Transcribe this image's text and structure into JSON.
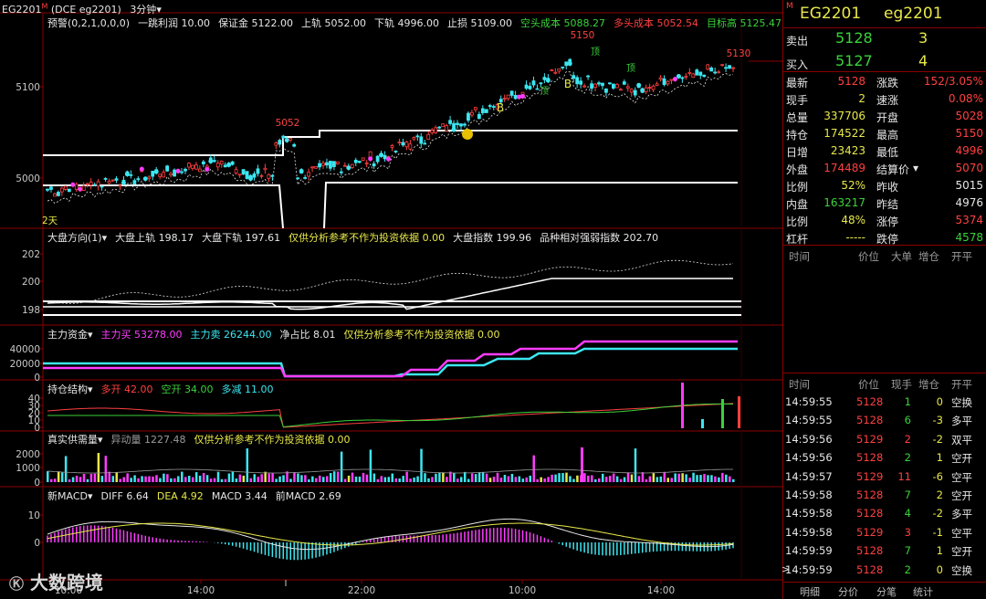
{
  "window": {
    "title": "EG2201",
    "marker": "M",
    "subtitle": "(DCE  eg2201)",
    "period": "3分钟"
  },
  "main_panel": {
    "label": "预警(0,2,1,0,0,0)",
    "items": [
      {
        "text": "一跳利润 10.00",
        "color": "#e6e6e6"
      },
      {
        "text": "保证金 5122.00",
        "color": "#e6e6e6"
      },
      {
        "text": "上轨 5052.00",
        "color": "#e6e6e6"
      },
      {
        "text": "下轨 4996.00",
        "color": "#e6e6e6"
      },
      {
        "text": "止损 5109.00",
        "color": "#e6e6e6"
      },
      {
        "text": "空头成本 5088.27",
        "color": "#3ad23a"
      },
      {
        "text": "多头成本 5052.54",
        "color": "#ff4040"
      },
      {
        "text": "目标高 5125.47",
        "color": "#3ad23a"
      }
    ],
    "y_ticks": [
      "5100",
      "5000"
    ],
    "annotations": {
      "high_a": "5150",
      "high_b": "5130",
      "mid": "5052",
      "days": "2天",
      "top1": "顶",
      "top2": "顶",
      "top3": "顶",
      "buy1": "B",
      "buy2": "B"
    }
  },
  "panel2": {
    "label": "大盘方向(1)",
    "items": [
      {
        "text": "大盘上轨 198.17",
        "color": "#e6e6e6"
      },
      {
        "text": "大盘下轨 197.61",
        "color": "#e6e6e6"
      },
      {
        "text": "仅供分析参考不作为投资依据 0.00",
        "color": "#e8e84a"
      },
      {
        "text": "大盘指数 199.96",
        "color": "#e6e6e6"
      },
      {
        "text": "品种相对强弱指数 202.70",
        "color": "#e6e6e6"
      }
    ],
    "y_ticks": [
      "202",
      "200",
      "198"
    ]
  },
  "panel3": {
    "label": "主力资金",
    "items": [
      {
        "text": "主力买 53278.00",
        "color": "#ff3cff"
      },
      {
        "text": "主力卖 26244.00",
        "color": "#3ce6f0"
      },
      {
        "text": "净占比 8.01",
        "color": "#e6e6e6"
      },
      {
        "text": "仅供分析参考不作为投资依据 0.00",
        "color": "#e8e84a"
      }
    ],
    "y_ticks": [
      "40000",
      "20000",
      "0"
    ]
  },
  "panel4": {
    "label": "持仓结构",
    "items": [
      {
        "text": "多开 42.00",
        "color": "#ff4040"
      },
      {
        "text": "空开 34.00",
        "color": "#3ad23a"
      },
      {
        "text": "多减 11.00",
        "color": "#3ce6f0"
      }
    ],
    "y_ticks": [
      "40",
      "30",
      "20",
      "10",
      "0"
    ]
  },
  "panel5": {
    "label": "真实供需量",
    "items": [
      {
        "text": "异动量 1227.48",
        "color": "#9a9a9a"
      },
      {
        "text": "仅供分析参考不作为投资依据 0.00",
        "color": "#e8e84a"
      }
    ],
    "y_ticks": [
      "2000",
      "1000",
      "0"
    ]
  },
  "panel6": {
    "label": "新MACD",
    "items": [
      {
        "text": "DIFF 6.64",
        "color": "#e6e6e6"
      },
      {
        "text": "DEA 4.92",
        "color": "#e8e84a"
      },
      {
        "text": "MACD 3.44",
        "color": "#e6e6e6"
      },
      {
        "text": "前MACD 2.69",
        "color": "#e6e6e6"
      }
    ],
    "y_ticks": [
      "10",
      "0"
    ]
  },
  "x_axis": {
    "ticks": [
      "10:00",
      "14:00",
      "22:00",
      "10:00",
      "14:00"
    ]
  },
  "watermark": "大数跨境",
  "quote": {
    "symbol": "EG2201",
    "symbol_lower": "eg2201",
    "marker": "M",
    "sell_label": "卖出",
    "sell_price": "5128",
    "sell_vol": "3",
    "buy_label": "买入",
    "buy_price": "5127",
    "buy_vol": "4",
    "rows": [
      {
        "l1": "最新",
        "v1": "5128",
        "c1": "#ff4040",
        "l2": "涨跌",
        "v2": "152/3.05%",
        "c2": "#ff4040"
      },
      {
        "l1": "现手",
        "v1": "2",
        "c1": "#e8e84a",
        "l2": "速涨",
        "v2": "0.08%",
        "c2": "#ff4040"
      },
      {
        "l1": "总量",
        "v1": "337706",
        "c1": "#e8e84a",
        "l2": "开盘",
        "v2": "5028",
        "c2": "#ff4040"
      },
      {
        "l1": "持仓",
        "v1": "174522",
        "c1": "#e8e84a",
        "l2": "最高",
        "v2": "5150",
        "c2": "#ff4040"
      },
      {
        "l1": "日增",
        "v1": "23423",
        "c1": "#e8e84a",
        "l2": "最低",
        "v2": "4996",
        "c2": "#ff4040"
      },
      {
        "l1": "外盘",
        "v1": "174489",
        "c1": "#ff4040",
        "l2": "结算价",
        "v2": "5070",
        "c2": "#ff4040"
      },
      {
        "l1": "比例",
        "v1": "52%",
        "c1": "#e8e84a",
        "l2": "昨收",
        "v2": "5015",
        "c2": "#e6e6e6"
      },
      {
        "l1": "内盘",
        "v1": "163217",
        "c1": "#3ad23a",
        "l2": "昨结",
        "v2": "4976",
        "c2": "#e6e6e6"
      },
      {
        "l1": "比例",
        "v1": "48%",
        "c1": "#e8e84a",
        "l2": "涨停",
        "v2": "5374",
        "c2": "#ff4040"
      },
      {
        "l1": "杠杆",
        "v1": "-----",
        "c1": "#e8e84a",
        "l2": "跌停",
        "v2": "4578",
        "c2": "#3ad23a"
      }
    ]
  },
  "big_orders": {
    "headers": [
      "时间",
      "价位",
      "大单",
      "增仓",
      "开平"
    ]
  },
  "ticks": {
    "headers": [
      "时间",
      "价位",
      "现手",
      "增仓",
      "开平"
    ],
    "rows": [
      {
        "time": "14:59:55",
        "price": "5128",
        "vol": "1",
        "oi": "0",
        "type": "空换",
        "vc": "#3ad23a"
      },
      {
        "time": "14:59:55",
        "price": "5128",
        "vol": "6",
        "oi": "-3",
        "type": "多平",
        "vc": "#3ad23a"
      },
      {
        "time": "14:59:56",
        "price": "5129",
        "vol": "2",
        "oi": "-2",
        "type": "双平",
        "vc": "#ff4040"
      },
      {
        "time": "14:59:56",
        "price": "5128",
        "vol": "2",
        "oi": "1",
        "type": "空开",
        "vc": "#3ad23a"
      },
      {
        "time": "14:59:57",
        "price": "5129",
        "vol": "11",
        "oi": "-6",
        "type": "空平",
        "vc": "#ff4040"
      },
      {
        "time": "14:59:58",
        "price": "5128",
        "vol": "7",
        "oi": "2",
        "type": "空开",
        "vc": "#3ad23a"
      },
      {
        "time": "14:59:58",
        "price": "5128",
        "vol": "4",
        "oi": "-2",
        "type": "多平",
        "vc": "#3ad23a"
      },
      {
        "time": "14:59:58",
        "price": "5129",
        "vol": "3",
        "oi": "-1",
        "type": "空平",
        "vc": "#ff4040"
      },
      {
        "time": "14:59:59",
        "price": "5128",
        "vol": "7",
        "oi": "1",
        "type": "空开",
        "vc": "#3ad23a"
      },
      {
        "time": "14:59:59",
        "price": "5128",
        "vol": "2",
        "oi": "0",
        "type": "空换",
        "vc": "#3ad23a"
      }
    ]
  },
  "tabs": [
    "明细",
    "分价",
    "分笔",
    "统计"
  ],
  "colors": {
    "up": "#ff4040",
    "down": "#3ad23a",
    "bg": "#000000",
    "border": "#8b0000"
  }
}
